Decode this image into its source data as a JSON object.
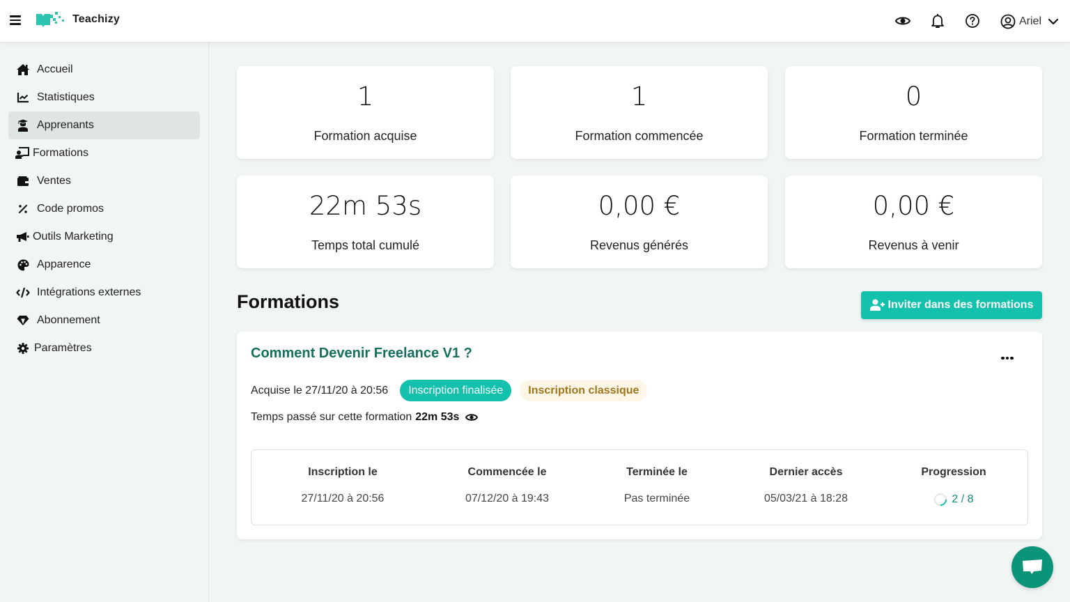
{
  "header": {
    "brand": "Teachizy",
    "user_name": "Ariel",
    "icons": [
      "menu-icon",
      "eye-icon",
      "bell-icon",
      "help-icon",
      "user-circle-icon",
      "chevron-down-icon"
    ]
  },
  "sidebar": {
    "items": [
      {
        "label": "Accueil",
        "icon": "home-icon",
        "active": false
      },
      {
        "label": "Statistiques",
        "icon": "chart-line-icon",
        "active": false
      },
      {
        "label": "Apprenants",
        "icon": "graduate-icon",
        "active": true
      },
      {
        "label": "Formations",
        "icon": "teacher-board-icon",
        "active": false
      },
      {
        "label": "Ventes",
        "icon": "wallet-icon",
        "active": false
      },
      {
        "label": "Code promos",
        "icon": "percent-icon",
        "active": false
      },
      {
        "label": "Outils Marketing",
        "icon": "megaphone-icon",
        "active": false
      },
      {
        "label": "Apparence",
        "icon": "palette-icon",
        "active": false
      },
      {
        "label": "Intégrations externes",
        "icon": "code-icon",
        "active": false
      },
      {
        "label": "Abonnement",
        "icon": "gem-icon",
        "active": false
      },
      {
        "label": "Paramètres",
        "icon": "cog-icon",
        "active": false
      }
    ]
  },
  "stats": [
    {
      "value": "1",
      "label": "Formation acquise"
    },
    {
      "value": "1",
      "label": "Formation commencée"
    },
    {
      "value": "0",
      "label": "Formation terminée"
    },
    {
      "value": "22m 53s",
      "label": "Temps total cumulé"
    },
    {
      "value": "0,00 €",
      "label": "Revenus générés"
    },
    {
      "value": "0,00 €",
      "label": "Revenus à venir"
    }
  ],
  "formations": {
    "title": "Formations",
    "invite_label": "Inviter dans des formations",
    "course": {
      "title": "Comment Devenir Freelance V1 ?",
      "acquired": "Acquise le 27/11/20 à 20:56",
      "badge_status": "Inscription finalisée",
      "badge_type": "Inscription classique",
      "time_label": "Temps passé sur cette formation",
      "time_value": "22m 53s",
      "columns": [
        {
          "head": "Inscription le",
          "value": "27/11/20 à 20:56"
        },
        {
          "head": "Commencée le",
          "value": "07/12/20 à 19:43"
        },
        {
          "head": "Terminée le",
          "value": "Pas terminée"
        },
        {
          "head": "Dernier accès",
          "value": "05/03/21 à 18:28"
        },
        {
          "head": "Progression",
          "value": "2 / 8"
        }
      ],
      "progress_fraction": 0.25
    }
  },
  "colors": {
    "accent": "#14c1ad",
    "title_green": "#146f5d",
    "fab": "#0b9478",
    "badge_beige_bg": "#fdf6e6",
    "badge_beige_text": "#a0741c"
  }
}
